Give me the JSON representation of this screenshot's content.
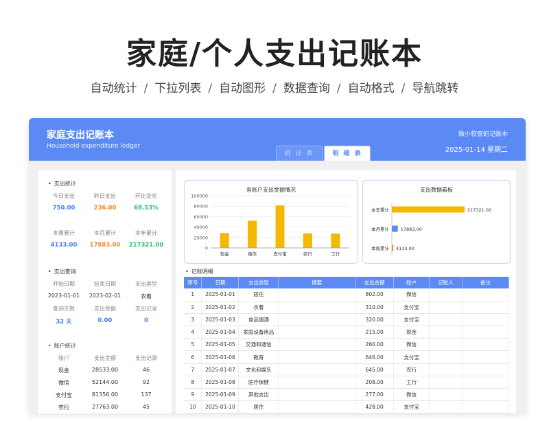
{
  "hero": {
    "title": "家庭/个人支出记账本",
    "features": [
      "自动统计",
      "下拉列表",
      "自动图形",
      "数据查询",
      "自动格式",
      "导航跳转"
    ],
    "separator": "/"
  },
  "app": {
    "title": "家庭支出记账本",
    "subtitle": "Household expenditure ledger",
    "brand": "微小软家的记账本",
    "date": "2025-01-14  星期二",
    "tabs": {
      "stats": "统 计 表",
      "detail": "明 细 表"
    }
  },
  "stats": {
    "section_title": "支出统计",
    "items": [
      {
        "label": "今日支出",
        "value": "750.00"
      },
      {
        "label": "昨日支出",
        "value": "236.00"
      },
      {
        "label": "环比变化",
        "value": "68.53%"
      },
      {
        "label": "本周累计",
        "value": "4133.00"
      },
      {
        "label": "本月累计",
        "value": "17883.00"
      },
      {
        "label": "本年累计",
        "value": "217321.00"
      }
    ]
  },
  "query": {
    "section_title": "支出查询",
    "headers": [
      "开始日期",
      "结束日期",
      "支出类型"
    ],
    "values": [
      "2023-01-01",
      "2023-02-01",
      "衣着"
    ],
    "headers2": [
      "查询天数",
      "支出金额",
      "支出记录"
    ],
    "values2": [
      "32 天",
      "0.00",
      "0"
    ]
  },
  "accounts": {
    "section_title": "账户统计",
    "headers": [
      "账户",
      "支出金额",
      "支出记录"
    ],
    "rows": [
      [
        "现金",
        "28533.00",
        "46"
      ],
      [
        "微信",
        "52144.00",
        "92"
      ],
      [
        "支付宝",
        "81356.00",
        "137"
      ],
      [
        "农行",
        "27763.00",
        "45"
      ]
    ]
  },
  "chart_data": [
    {
      "type": "bar",
      "title": "各账户支出金额情况",
      "categories": [
        "现金",
        "微信",
        "支付宝",
        "农行",
        "工行"
      ],
      "values": [
        28533,
        52144,
        81356,
        27763,
        27525
      ],
      "ylim": [
        0,
        100000
      ],
      "yticks": [
        "0",
        "20000",
        "40000",
        "60000",
        "80000",
        "100000"
      ],
      "color": "#f5b800"
    },
    {
      "type": "bar",
      "orientation": "horizontal",
      "title": "支出数据看板",
      "categories": [
        "本年累计",
        "本月累计",
        "本周累计"
      ],
      "values": [
        217321.0,
        17883.0,
        4133.0
      ],
      "value_labels": [
        "217321.00",
        "17883.00",
        "4133.00"
      ],
      "colors": [
        "#f5b800",
        "#5b8af5",
        "#ef8a2e"
      ]
    }
  ],
  "detail": {
    "section_title": "记账明细",
    "headers": [
      "序号",
      "日期",
      "支出类型",
      "摘要",
      "支出金额",
      "账户",
      "记账人",
      "备注"
    ],
    "rows": [
      [
        "1",
        "2025-01-01",
        "居住",
        "",
        "802.00",
        "微信",
        "",
        ""
      ],
      [
        "2",
        "2025-01-02",
        "衣着",
        "",
        "310.00",
        "支付宝",
        "",
        ""
      ],
      [
        "3",
        "2025-01-03",
        "食品烟酒",
        "",
        "320.00",
        "支付宝",
        "",
        ""
      ],
      [
        "4",
        "2025-01-04",
        "家庭设备用品",
        "",
        "215.00",
        "现金",
        "",
        ""
      ],
      [
        "5",
        "2025-01-05",
        "交通和通信",
        "",
        "260.00",
        "微信",
        "",
        ""
      ],
      [
        "6",
        "2025-01-06",
        "教育",
        "",
        "646.00",
        "支付宝",
        "",
        ""
      ],
      [
        "7",
        "2025-01-07",
        "文化和娱乐",
        "",
        "645.00",
        "农行",
        "",
        ""
      ],
      [
        "8",
        "2025-01-08",
        "医疗保健",
        "",
        "208.00",
        "工行",
        "",
        ""
      ],
      [
        "9",
        "2025-01-09",
        "其他支出",
        "",
        "277.00",
        "微信",
        "",
        ""
      ],
      [
        "10",
        "2025-01-10",
        "居住",
        "",
        "428.00",
        "支付宝",
        "",
        ""
      ]
    ]
  }
}
